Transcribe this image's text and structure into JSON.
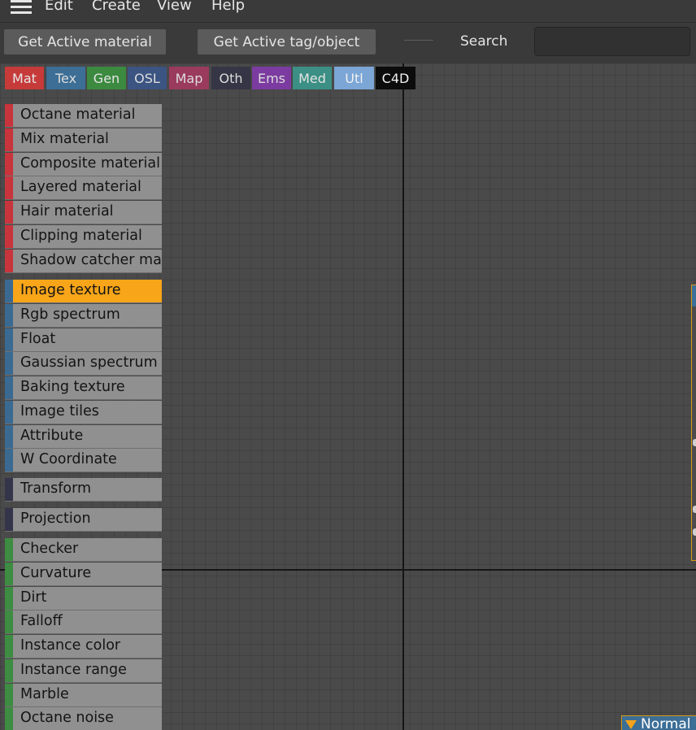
{
  "menu": {
    "items": [
      {
        "id": "edit",
        "label": "Edit"
      },
      {
        "id": "create",
        "label": "Create"
      },
      {
        "id": "view",
        "label": "View"
      },
      {
        "id": "help",
        "label": "Help"
      }
    ]
  },
  "toolbar": {
    "get_active_material_label": "Get Active material",
    "get_active_tag_label": "Get Active tag/object",
    "search_label": "Search",
    "search_value": "",
    "search_placeholder": ""
  },
  "categories": [
    {
      "label": "Mat",
      "bg": "#c63a3a",
      "fg": "#e8e8e8"
    },
    {
      "label": "Tex",
      "bg": "#3c6e96",
      "fg": "#dcdcdc"
    },
    {
      "label": "Gen",
      "bg": "#3b8a3f",
      "fg": "#e4e4e4"
    },
    {
      "label": "OSL",
      "bg": "#3b5482",
      "fg": "#dcdcdc"
    },
    {
      "label": "Map",
      "bg": "#9a3a5c",
      "fg": "#dcdcdc"
    },
    {
      "label": "Oth",
      "bg": "#353545",
      "fg": "#dcdcdc"
    },
    {
      "label": "Ems",
      "bg": "#7b3ba0",
      "fg": "#dcdcdc"
    },
    {
      "label": "Med",
      "bg": "#3b8f84",
      "fg": "#e4e4e4"
    },
    {
      "label": "Utl",
      "bg": "#7ba6d6",
      "fg": "#f0f0f0"
    },
    {
      "label": "C4D",
      "bg": "#0c0c0c",
      "fg": "#f0f0f0"
    }
  ],
  "node_groups": [
    {
      "category": "Mat",
      "color": "#c8343c",
      "items": [
        "Octane material",
        "Mix material",
        "Composite material",
        "Layered material",
        "Hair material",
        "Clipping material",
        "Shadow catcher material"
      ]
    },
    {
      "category": "Tex",
      "color": "#3a6a92",
      "items": [
        "Image texture",
        "Rgb spectrum",
        "Float",
        "Gaussian spectrum",
        "Baking texture",
        "Image tiles",
        "Attribute",
        "W Coordinate"
      ]
    },
    {
      "category": "Oth",
      "color": "#34344a",
      "items": [
        "Transform"
      ]
    },
    {
      "category": "Oth",
      "color": "#34344a",
      "items": [
        "Projection"
      ]
    },
    {
      "category": "Gen",
      "color": "#3e8c42",
      "items": [
        "Checker",
        "Curvature",
        "Dirt",
        "Falloff",
        "Instance color",
        "Instance range",
        "Marble",
        "Octane noise"
      ]
    }
  ],
  "selected_node": "Image texture",
  "selected_color": "#f8a519",
  "bottom_node": {
    "label": "Normal"
  }
}
